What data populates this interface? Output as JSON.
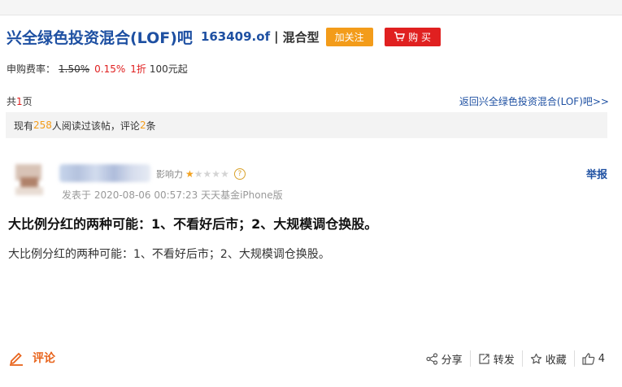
{
  "header": {
    "title": "兴全绿色投资混合(LOF)吧",
    "code": "163409.of",
    "separator": "|",
    "fund_type": "混合型",
    "follow_label": "加关注",
    "buy_label": "购 买"
  },
  "fee": {
    "label": "申购费率：",
    "original": "1.50%",
    "current": "0.15%",
    "discount": "1折",
    "minimum": "100元起"
  },
  "pagination": {
    "prefix": "共",
    "count": "1",
    "suffix": "页",
    "back_link": "返回兴全绿色投资混合(LOF)吧>>"
  },
  "reads": {
    "prefix": "现有",
    "reader_count": "258",
    "middle": "人阅读过该帖，评论",
    "comment_count": "2",
    "suffix": "条"
  },
  "post": {
    "influence_label": "影响力",
    "influence_rating": 0.5,
    "influence_max": 5,
    "meta": "发表于 2020-08-06 00:57:23 天天基金iPhone版",
    "report_label": "举报",
    "title": "大比例分红的两种可能：1、不看好后市；2、大规模调仓换股。",
    "body": "大比例分红的两种可能：1、不看好后市；2、大规模调仓换股。"
  },
  "footer": {
    "comment_label": "评论",
    "share_label": "分享",
    "forward_label": "转发",
    "favorite_label": "收藏",
    "like_count": "4"
  },
  "colors": {
    "brand_blue": "#1e50a2",
    "follow_orange": "#f39c1a",
    "buy_red": "#e02020",
    "comment_orange": "#e8641c"
  },
  "icons": [
    "cart-icon",
    "star-icon",
    "question-icon",
    "edit-icon",
    "share-icon",
    "forward-icon",
    "favorite-star-icon",
    "thumbs-up-icon"
  ]
}
